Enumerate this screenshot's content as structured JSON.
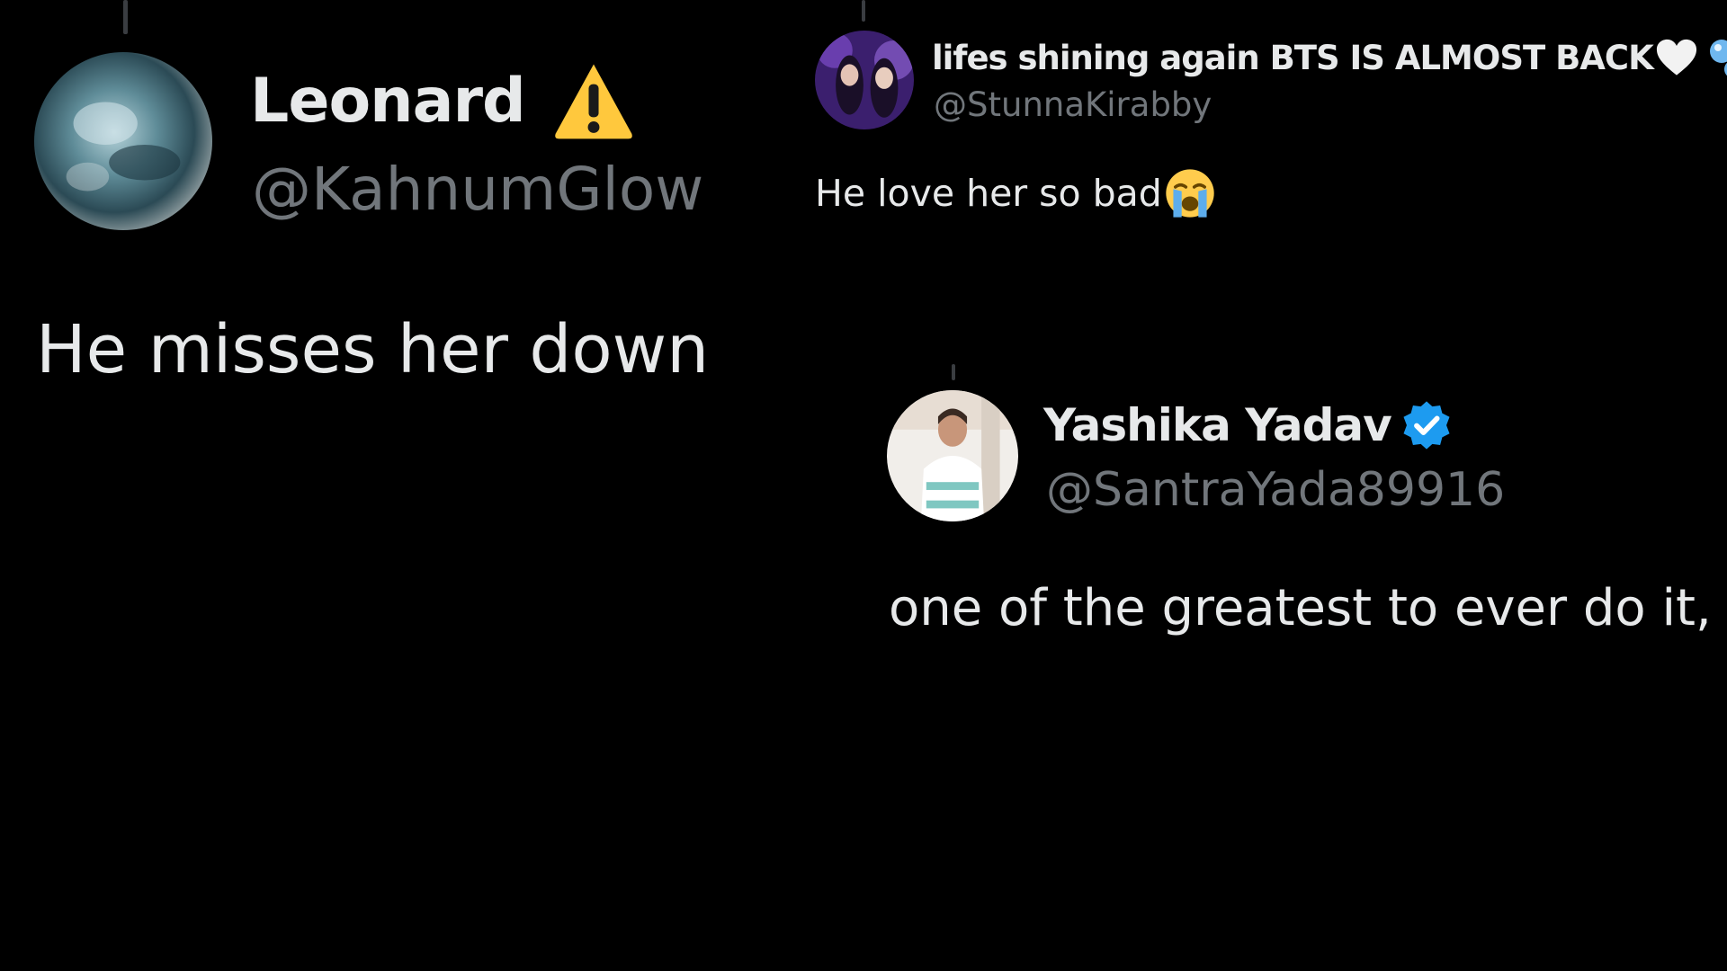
{
  "tweets": [
    {
      "display_name": "Leonard",
      "badge_icon": "warning-icon",
      "handle": "@KahnumGlow",
      "text": "He misses her down"
    },
    {
      "display_name": "lifes shining again BTS IS ALMOST BACK",
      "name_emojis": [
        "white-heart-icon",
        "bubbles-icon"
      ],
      "handle": "@StunnaKirabby",
      "text": "He love her so bad",
      "text_emoji": "loudly-crying-face-icon"
    },
    {
      "display_name": "Yashika Yadav",
      "badge_icon": "verified-badge-icon",
      "handle": "@SantraYada89916",
      "text": "one of the greatest to ever do it,"
    }
  ],
  "colors": {
    "background": "#000000",
    "primary_text": "#e7e9ea",
    "secondary_text": "#71767b",
    "verified_blue": "#1d9bf0",
    "warning_yellow": "#ffc83d"
  }
}
